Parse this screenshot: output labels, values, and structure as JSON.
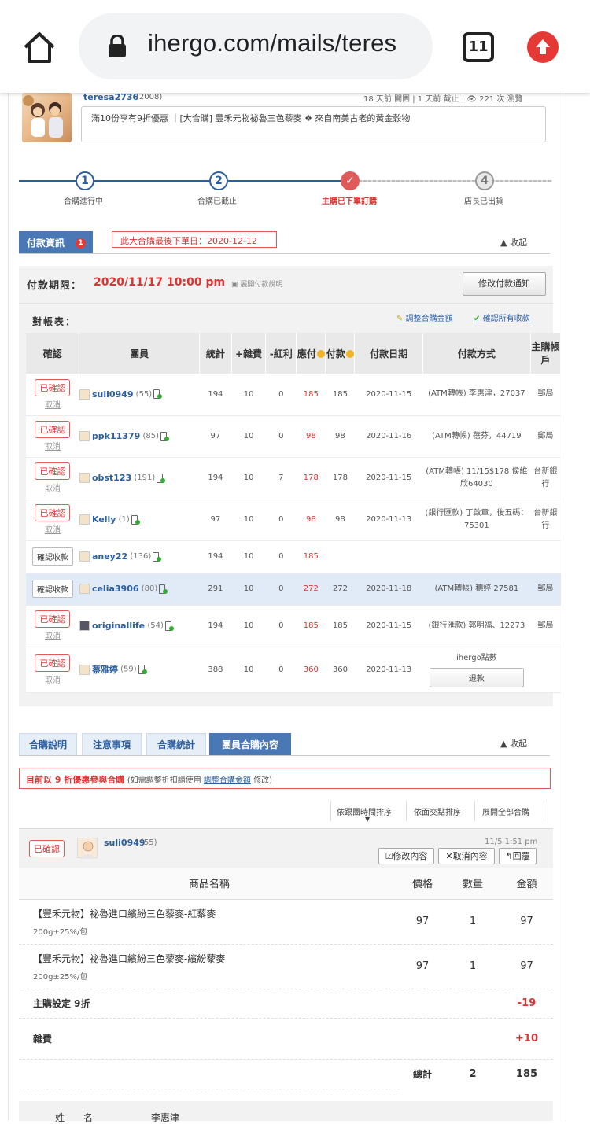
{
  "browser": {
    "url": "ihergo.com/mails/teres",
    "tab_count": "11",
    "accent": "#e53935"
  },
  "post": {
    "author": "teresa2736",
    "author_score": "(2008)",
    "meta": "18 天前 開團 | 1 天前 截止 | 👁 221 次 瀏覽",
    "text": "滿10份享有9折優惠 ｜[大合購] 豐禾元物祕魯三色藜麥 ❖ 來自南美古老的黃金穀物"
  },
  "steps": [
    {
      "number": "1",
      "label": "合購進行中"
    },
    {
      "number": "2",
      "label": "合購已截止"
    },
    {
      "number": "✓",
      "label": "主購已下單訂購"
    },
    {
      "number": "4",
      "label": "店長已出貨"
    }
  ],
  "payment": {
    "tab_label": "付款資訊",
    "tab_badge": "1",
    "deadline_note": "此大合購最後下單日：2020-12-12",
    "collapse": "▲ 收起",
    "deadline_label": "付款期限：",
    "deadline_value": "2020/11/17  10:00 pm",
    "expand_link": "▣ 展開付款說明",
    "modify_button": "修改付款通知",
    "recon_label": "對帳表：",
    "adjust_link": "調整合購金額",
    "confirm_all_link": "確認所有收款"
  },
  "recon_table": {
    "headers": [
      "確認",
      "團員",
      "統計",
      "+雜費",
      "-紅利",
      "應付",
      "付款",
      "付款日期",
      "付款方式",
      "主購帳戶"
    ],
    "rows": [
      {
        "status": "已確認",
        "cancel": "取消",
        "member": "suli0949",
        "score": "(55)",
        "total": "194",
        "fee": "10",
        "bonus": "0",
        "due": "185",
        "paid": "185",
        "date": "2020-11-15",
        "method": "(ATM轉帳) 李惠津，27037",
        "account": "郵局"
      },
      {
        "status": "已確認",
        "cancel": "取消",
        "member": "ppk11379",
        "score": "(85)",
        "total": "97",
        "fee": "10",
        "bonus": "0",
        "due": "98",
        "paid": "98",
        "date": "2020-11-16",
        "method": "(ATM轉帳) 蓓芬，44719",
        "account": "郵局"
      },
      {
        "status": "已確認",
        "cancel": "取消",
        "member": "obst123",
        "score": "(191)",
        "total": "194",
        "fee": "10",
        "bonus": "7",
        "due": "178",
        "paid": "178",
        "date": "2020-11-15",
        "method": "(ATM轉帳) 11/15$178 侯維欣64030",
        "account": "台新銀行"
      },
      {
        "status": "已確認",
        "cancel": "取消",
        "member": "Kelly",
        "score": "(1)",
        "total": "97",
        "fee": "10",
        "bonus": "0",
        "due": "98",
        "paid": "98",
        "date": "2020-11-13",
        "method": "(銀行匯款) 丁啟章，後五碼：75301",
        "account": "台新銀行"
      },
      {
        "status": "確認收款",
        "cancel": "",
        "member": "aney22",
        "score": "(136)",
        "total": "194",
        "fee": "10",
        "bonus": "0",
        "due": "185",
        "paid": "",
        "date": "",
        "method": "",
        "account": ""
      },
      {
        "status": "確認收款",
        "cancel": "",
        "member": "celia3906",
        "score": "(80)",
        "total": "291",
        "fee": "10",
        "bonus": "0",
        "due": "272",
        "paid": "272",
        "date": "2020-11-18",
        "method": "(ATM轉帳) 穗婷 27581",
        "account": "郵局"
      },
      {
        "status": "已確認",
        "cancel": "取消",
        "member": "originallife",
        "score": "(54)",
        "total": "194",
        "fee": "10",
        "bonus": "0",
        "due": "185",
        "paid": "185",
        "date": "2020-11-15",
        "method": "(銀行匯款) 郭明福、12273",
        "account": "郵局"
      },
      {
        "status": "已確認",
        "cancel": "取消",
        "member": "蔡雅婷",
        "score": "(59)",
        "total": "388",
        "fee": "10",
        "bonus": "0",
        "due": "360",
        "paid": "360",
        "date": "2020-11-13",
        "method": "ihergo點數",
        "refund": "退款",
        "account": ""
      }
    ]
  },
  "group_tabs": [
    "合購說明",
    "注意事項",
    "合購統計",
    "團員合購內容"
  ],
  "group_collapse": "▲ 收起",
  "discount_notice": {
    "main": "目前以 9 折優惠參與合購",
    "pre": "(如需調整折扣請使用 ",
    "link": "調整合購金額",
    "post": " 修改)"
  },
  "sort": [
    "依跟團時間排序",
    "依面交點排序",
    "展開全部合購"
  ],
  "order": {
    "status": "已確認",
    "user": "suli0949",
    "score": "(55)",
    "time": "11/5  1:51 pm",
    "btn_edit": "修改內容",
    "btn_cancel": "取消內容",
    "btn_reply": "回覆",
    "headers": [
      "商品名稱",
      "價格",
      "數量",
      "金額"
    ],
    "items": [
      {
        "name": "【豐禾元物】祕魯進口繽紛三色藜麥-紅藜麥",
        "spec": "200g±25%/包",
        "price": "97",
        "qty": "1",
        "amount": "97"
      },
      {
        "name": "【豐禾元物】祕魯進口繽紛三色藜麥-繽紛藜麥",
        "spec": "200g±25%/包",
        "price": "97",
        "qty": "1",
        "amount": "97"
      }
    ],
    "discount_label": "主購設定 9折",
    "discount_value": "-19",
    "fee_label": "雜費",
    "fee_value": "+10",
    "total_label": "總計",
    "total_qty": "2",
    "total_amount": "185",
    "bottom_label": "姓　　名",
    "bottom_value": "李惠津"
  }
}
